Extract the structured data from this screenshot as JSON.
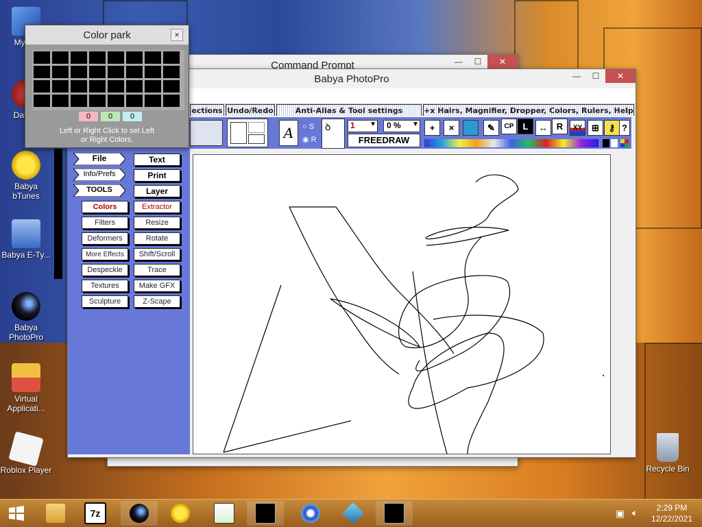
{
  "desktop": {
    "icons": [
      {
        "label": "My Co",
        "icon": "computer-icon"
      },
      {
        "label": "DataW",
        "icon": "datawriter-icon"
      },
      {
        "label": "Babya bTunes",
        "icon": "sun-icon"
      },
      {
        "label": "Babya E-Ty...",
        "icon": "document-icon"
      },
      {
        "label": "Babya PhotoPro",
        "icon": "camera-lens-icon"
      },
      {
        "label": "Virtual Applicati...",
        "icon": "virtual-app-icon"
      },
      {
        "label": "Roblox Player",
        "icon": "roblox-icon"
      },
      {
        "label": "Recycle Bin",
        "icon": "recycle-bin-icon"
      }
    ]
  },
  "cmd_window": {
    "title": "Command Prompt"
  },
  "photopro": {
    "title": "Babya PhotoPro",
    "tabs": [
      "ections",
      "Undo/Redo",
      "Anti-Alias & Tool settings",
      "+x Hairs, Magnifier, Dropper, Colors, Rulers, Help"
    ],
    "tool_settings": {
      "size_value": "1",
      "opacity_value": "0 %",
      "mode_label": "FREEDRAW",
      "radio_s": "S",
      "radio_r": "R"
    },
    "tool_icons": [
      "+",
      "×",
      "",
      "",
      "CP",
      "L",
      "↔",
      "R",
      "XY",
      "",
      "",
      "?"
    ],
    "left_arrow_buttons": [
      "File",
      "Info/Prefs",
      "TOOLS"
    ],
    "left_buttons": [
      "Colors",
      "Filters",
      "Deformers",
      "More Effects",
      "Despeckle",
      "Textures",
      "Sculpture"
    ],
    "right_buttons": [
      "Text",
      "Print",
      "Layer",
      "Extractor",
      "Resize",
      "Rotate",
      "Shift/Scroll",
      "Trace",
      "Make GFX",
      "Z-Scape"
    ]
  },
  "color_park": {
    "title": "Color park",
    "values": [
      "0",
      "0",
      "0"
    ],
    "hint_line1": "Left or Right Click to set Left",
    "hint_line2": "or Right Colors."
  },
  "window_controls": {
    "minimize": "—",
    "maximize": "☐",
    "close": "✕"
  },
  "taskbar": {
    "apps": [
      "file-explorer-icon",
      "7zip-icon",
      "photopro-icon",
      "btunes-icon",
      "notepad-icon",
      "cmd-icon",
      "installer-icon",
      "virtualbox-icon",
      "cmd-icon"
    ],
    "sevenzip_label": "7z",
    "time": "2:29 PM",
    "date": "12/22/2021"
  }
}
